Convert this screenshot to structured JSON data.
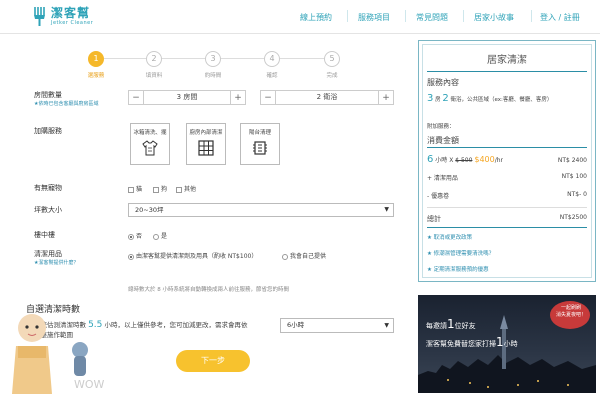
{
  "brand": {
    "name": "潔客幫",
    "sub": "Jetker Cleaner"
  },
  "nav": [
    "線上預約",
    "服務項目",
    "常見問題",
    "居家小故事",
    "登入 / 註冊"
  ],
  "steps": [
    {
      "n": "1",
      "label": "選服務"
    },
    {
      "n": "2",
      "label": "填資料"
    },
    {
      "n": "3",
      "label": "約時間"
    },
    {
      "n": "4",
      "label": "確認"
    },
    {
      "n": "5",
      "label": "完成"
    }
  ],
  "form": {
    "rooms_label": "房間數量",
    "rooms_note": "★依時已包含客廳與廚房區域",
    "rooms_value": "3 房間",
    "baths_value": "2 衛浴",
    "addon_label": "加購服務",
    "addons": [
      "冰箱清洗、擺",
      "廚房內部清潔",
      "陽台清理"
    ],
    "pets_label": "有無寵物",
    "pets_options": [
      "貓",
      "狗",
      "其他"
    ],
    "size_label": "坪數大小",
    "size_value": "20~30坪",
    "floor_label": "樓中樓",
    "floor_options": [
      "否",
      "是"
    ],
    "supplies_label": "清潔用品",
    "supplies_note": "★潔客幫提供什麼？",
    "supplies_opt1": "由潔客幫提供清潔劑及用具（酌收 NT$100）",
    "supplies_opt2": "我會自己提供",
    "hint": "總時數大於 8 小時系統將自動轉換成兩人前往服務，節省您的時間",
    "hours_title": "自選清潔時數",
    "hours_desc_1": "系統估測清潔時數",
    "hours_value": "5.5",
    "hours_desc_2": "小時，以上僅供參考，您可加減更改，需求會再依",
    "hours_desc_3": "調整施作範圍",
    "hours_select": "6小時",
    "next_label": "下一步"
  },
  "panel": {
    "title": "居家清潔",
    "content_head": "服務內容",
    "rooms_n": "3",
    "rooms_unit": "房",
    "baths_n": "2",
    "baths_text": "衛浴，公共區域（ex:客廳、餐廳、客房）",
    "addon_text": "附加服務：",
    "fee_head": "消費金額",
    "hours_n": "6",
    "rate_prefix": "小時 X",
    "rate_old": "$ 500",
    "rate_new": "$400",
    "rate_unit": "/hr",
    "rate_total": "NT$ 2400",
    "supplies": "+ 清潔用品",
    "supplies_price": "NT$ 100",
    "coupon": "- 優惠卷",
    "coupon_price": "NT$- 0",
    "total_label": "總計",
    "total_value": "NT$2500",
    "links": [
      "★ 取消或更改政策",
      "★ 修潮濕管理需要清洗嗎？",
      "★ 定期清潔服務預約優惠"
    ]
  },
  "banner": {
    "line1": "每邀請",
    "num1": "1",
    "line1b": "位好友",
    "line2": "潔客幫免費替您家打掃",
    "num2": "1",
    "line2b": "小時",
    "badge1": "一起刷刷",
    "badge2": "消失夏夜吧！"
  },
  "colors": {
    "brand": "#2fa3b8",
    "accent": "#f5b82a",
    "text": "#444444"
  }
}
